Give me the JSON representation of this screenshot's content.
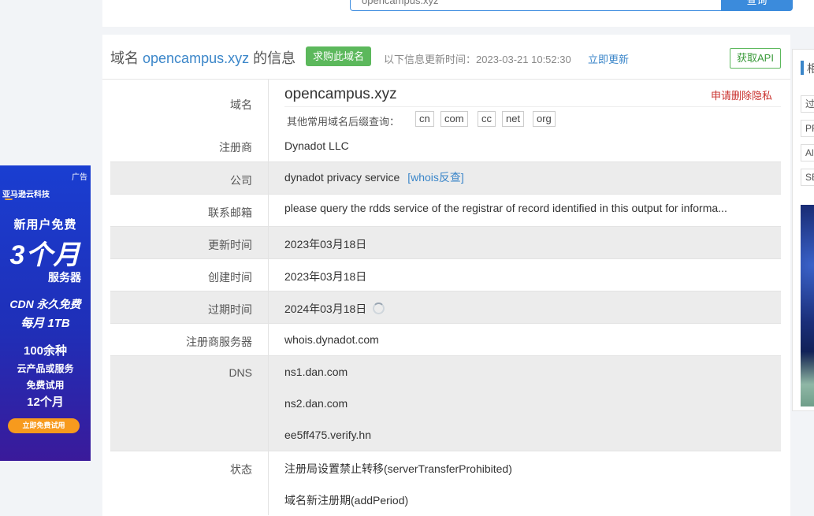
{
  "search": {
    "value": "opencampus.xyz",
    "button_label": "查询"
  },
  "ad": {
    "tag": "广告",
    "brand": "亚马逊云科技",
    "line1": "新用户免费",
    "line2": "3个月",
    "line3": "服务器",
    "line4": "CDN 永久免费",
    "line5": "每月 1TB",
    "line6": "100余种",
    "line7": "云产品或服务",
    "line8": "免费试用",
    "line9": "12个月",
    "button": "立即免费试用"
  },
  "header": {
    "title_prefix": "域名",
    "domain": "opencampus.xyz",
    "title_suffix": "的信息",
    "buy_button": "求购此域名",
    "update_label": "以下信息更新时间：2023-03-21 10:52:30",
    "update_now": "立即更新",
    "api_button": "获取API"
  },
  "domain_row": {
    "label": "域名",
    "value": "opencampus.xyz",
    "privacy_link": "申请删除隐私",
    "suffix_label": "其他常用域名后缀查询：",
    "suffixes": [
      "cn",
      "com",
      "cc",
      "net",
      "org"
    ]
  },
  "rows": {
    "registrar": {
      "label": "注册商",
      "value": "Dynadot LLC"
    },
    "company": {
      "label": "公司",
      "value": "dynadot privacy service",
      "link": "[whois反查]"
    },
    "email": {
      "label": "联系邮箱",
      "value": "please query the rdds service of the registrar of record identified in this output for informa..."
    },
    "updated": {
      "label": "更新时间",
      "value": "2023年03月18日"
    },
    "created": {
      "label": "创建时间",
      "value": "2023年03月18日"
    },
    "expires": {
      "label": "过期时间",
      "value": "2024年03月18日"
    },
    "whois_server": {
      "label": "注册商服务器",
      "value": "whois.dynadot.com"
    },
    "dns": {
      "label": "DNS",
      "values": [
        "ns1.dan.com",
        "ns2.dan.com",
        "ee5ff475.verify.hn"
      ]
    },
    "status": {
      "label": "状态",
      "values": [
        "注册局设置禁止转移(serverTransferProhibited)",
        "域名新注册期(addPeriod)"
      ]
    }
  },
  "sidebar": {
    "head": "相",
    "items": [
      "过",
      "PR",
      "Al",
      "SE"
    ]
  }
}
